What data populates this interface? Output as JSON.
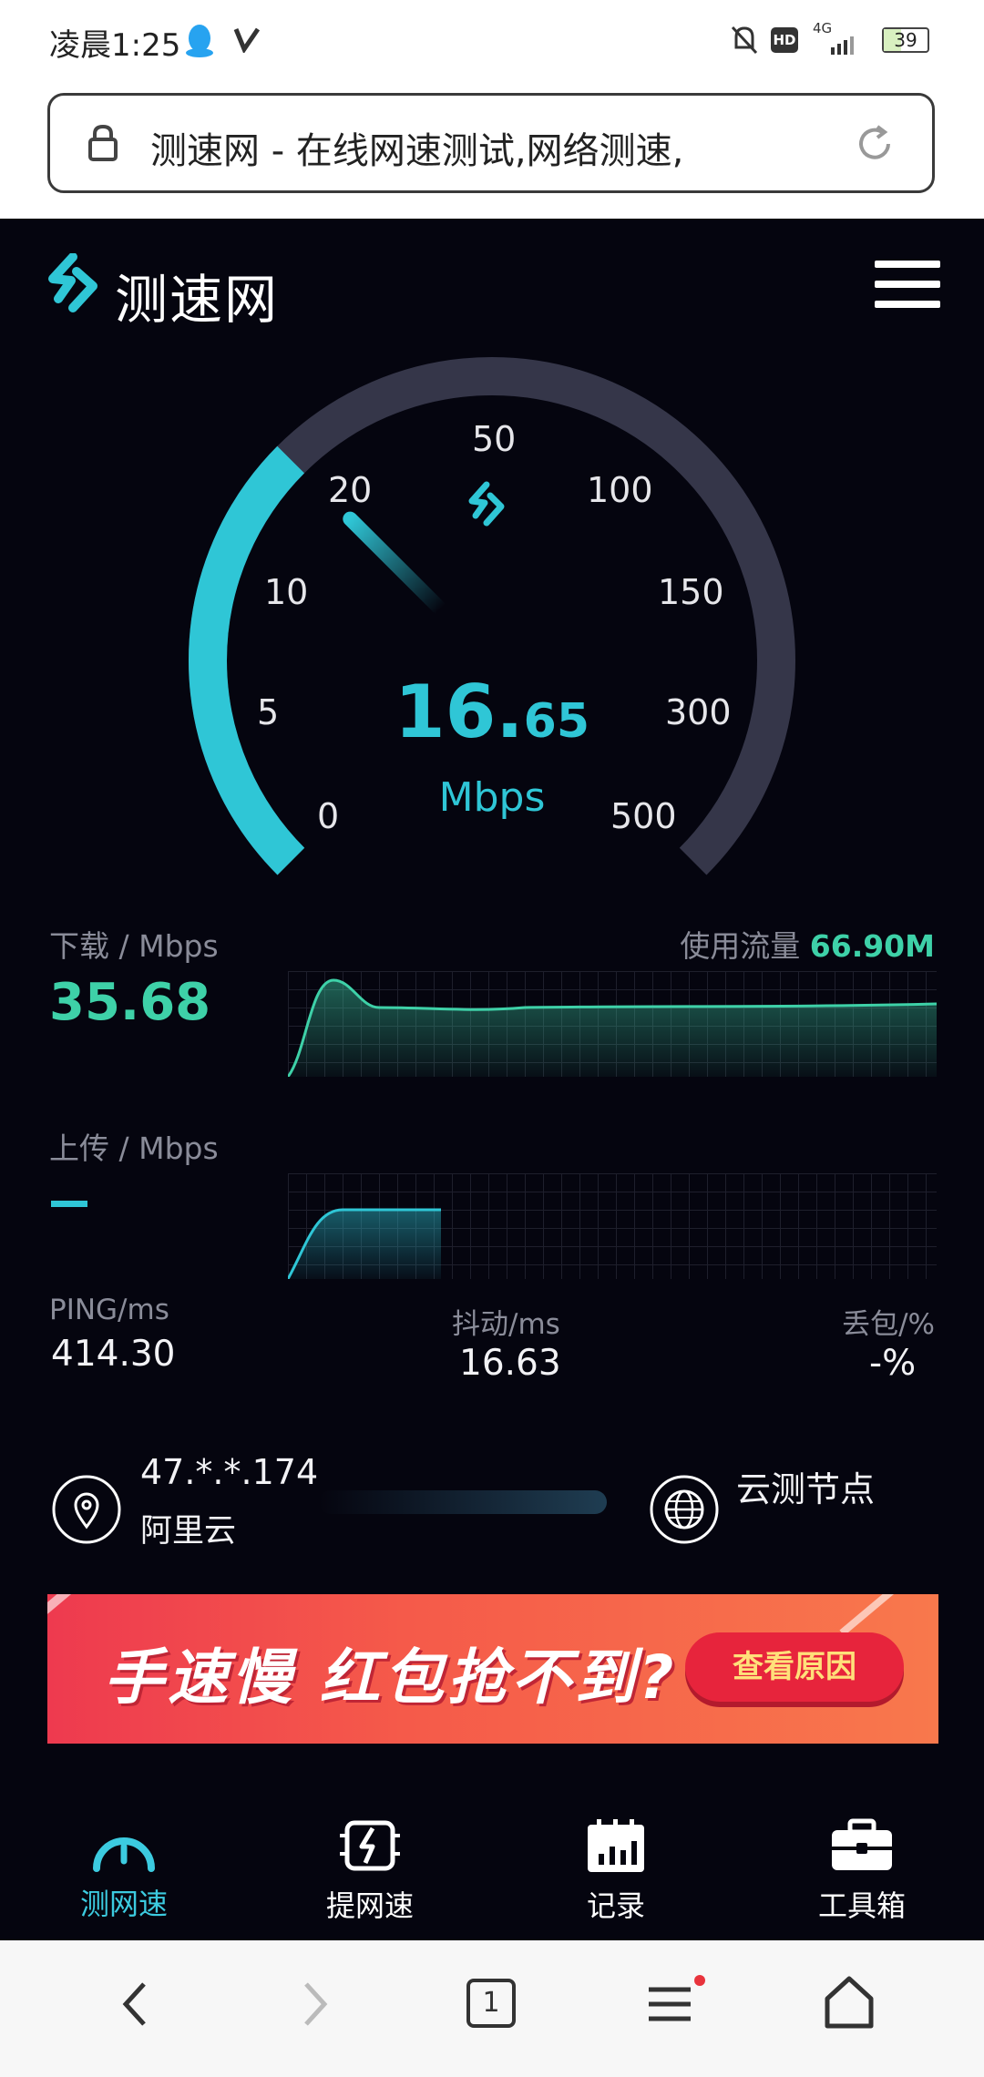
{
  "status_bar": {
    "time": "凌晨1:25",
    "network": "4G",
    "battery": "39",
    "hd_badge": "HD",
    "icons": [
      "qq-icon",
      "v-icon",
      "mute-bell-icon",
      "hd-icon",
      "signal-icon",
      "battery-icon"
    ]
  },
  "browser": {
    "url_title": "测速网 - 在线网速测试,网络测速,",
    "tab_count": "1"
  },
  "app": {
    "logo": "测速网",
    "gauge": {
      "ticks": [
        "0",
        "5",
        "10",
        "20",
        "50",
        "100",
        "150",
        "300",
        "500"
      ],
      "speed_int": "16.",
      "speed_dec": "65",
      "unit": "Mbps",
      "value": 16.65
    },
    "download": {
      "label": "下载 / Mbps",
      "value": "35.68",
      "traffic_label": "使用流量",
      "traffic_value": "66.90M"
    },
    "upload": {
      "label": "上传 / Mbps",
      "value": "–"
    },
    "metrics": {
      "ping_label": "PING/ms",
      "ping_value": "414.30",
      "jitter_label": "抖动/ms",
      "jitter_value": "16.63",
      "loss_label": "丢包/%",
      "loss_value": "-%"
    },
    "node": {
      "ip": "47.*.*.174",
      "isp": "阿里云",
      "server": "云测节点"
    },
    "banner": {
      "slogan": "手速慢 红包抢不到?",
      "button": "查看原因"
    },
    "nav": [
      {
        "label": "测网速",
        "icon": "speedometer-icon",
        "active": true
      },
      {
        "label": "提网速",
        "icon": "chip-bolt-icon",
        "active": false
      },
      {
        "label": "记录",
        "icon": "calendar-chart-icon",
        "active": false
      },
      {
        "label": "工具箱",
        "icon": "toolbox-icon",
        "active": false
      }
    ]
  },
  "colors": {
    "accent_cyan": "#2fc6d6",
    "accent_green": "#3ed1a8",
    "background": "#05050f",
    "gauge_track": "#353649",
    "banner_red": "#ee3a4f"
  }
}
